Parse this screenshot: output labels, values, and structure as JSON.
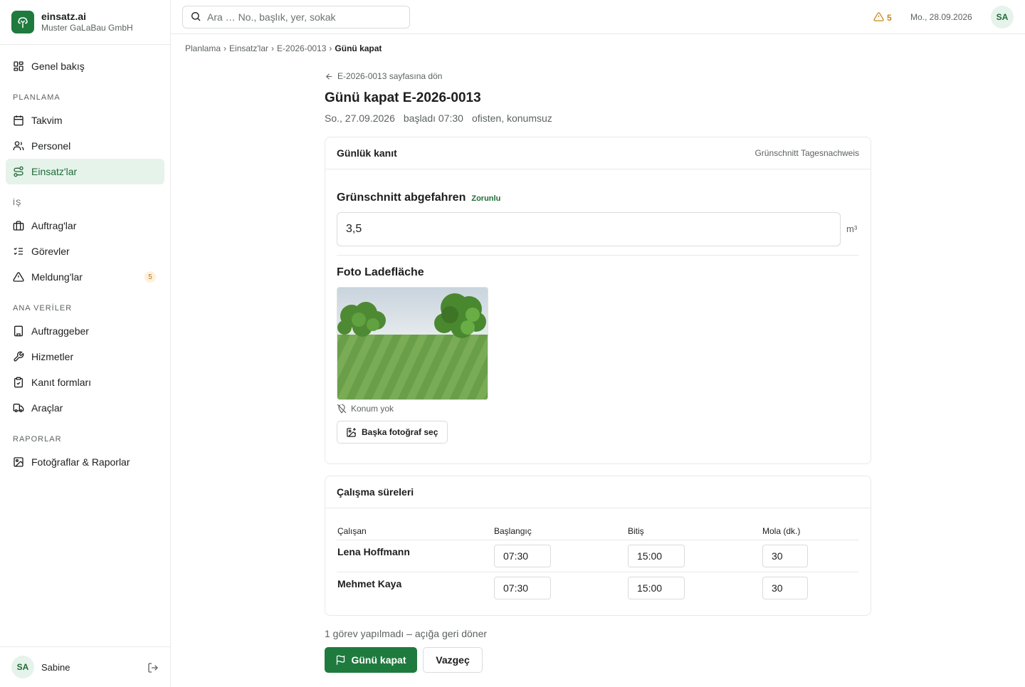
{
  "app": {
    "name": "einsatz.ai",
    "org": "Muster GaLaBau GmbH"
  },
  "sidebar": {
    "overview": "Genel bakış",
    "sections": {
      "planning": "PLANLAMA",
      "work": "İŞ",
      "master": "ANA VERİLER",
      "reports": "RAPORLAR"
    },
    "items": {
      "calendar": "Takvim",
      "staff": "Personel",
      "einsatz": "Einsatz'lar",
      "auftrag": "Auftrag'lar",
      "tasks": "Görevler",
      "meldung": "Meldung'lar",
      "meldung_count": "5",
      "clients": "Auftraggeber",
      "services": "Hizmetler",
      "forms": "Kanıt formları",
      "vehicles": "Araçlar",
      "photos": "Fotoğraflar & Raporlar"
    },
    "user": {
      "initials": "SA",
      "name": "Sabine"
    }
  },
  "topbar": {
    "search_placeholder": "Ara … No., başlık, yer, sokak",
    "alert_count": "5",
    "date": "Mo., 28.09.2026",
    "avatar": "SA"
  },
  "breadcrumb": [
    "Planlama",
    "Einsatz'lar",
    "E-2026-0013",
    "Günü kapat"
  ],
  "page": {
    "back": "E-2026-0013 sayfasına dön",
    "title": "Günü kapat E-2026-0013",
    "meta_date": "So., 27.09.2026",
    "meta_start": "başladı 07:30",
    "meta_loc": "ofisten, konumsuz"
  },
  "evidence": {
    "title": "Günlük kanıt",
    "form_name": "Grünschnitt Tagesnachweis",
    "field1_label": "Grünschnitt abgefahren",
    "required": "Zorunlu",
    "field1_value": "3,5",
    "unit": "m³",
    "field2_label": "Foto Ladefläche",
    "no_location": "Konum yok",
    "choose_photo": "Başka fotoğraf seç"
  },
  "worktime": {
    "title": "Çalışma süreleri",
    "columns": [
      "Çalışan",
      "Başlangıç",
      "Bitiş",
      "Mola (dk.)"
    ],
    "rows": [
      {
        "name": "Lena Hoffmann",
        "start": "07:30",
        "end": "15:00",
        "break": "30"
      },
      {
        "name": "Mehmet Kaya",
        "start": "07:30",
        "end": "15:00",
        "break": "30"
      }
    ]
  },
  "footer": {
    "pending": "1 görev yapılmadı – açığa geri döner",
    "close_day": "Günü kapat",
    "cancel": "Vazgeç"
  },
  "colors": {
    "accent": "#1f7a3e",
    "accent_soft": "#e6f3ea",
    "warning": "#c48a1a"
  }
}
